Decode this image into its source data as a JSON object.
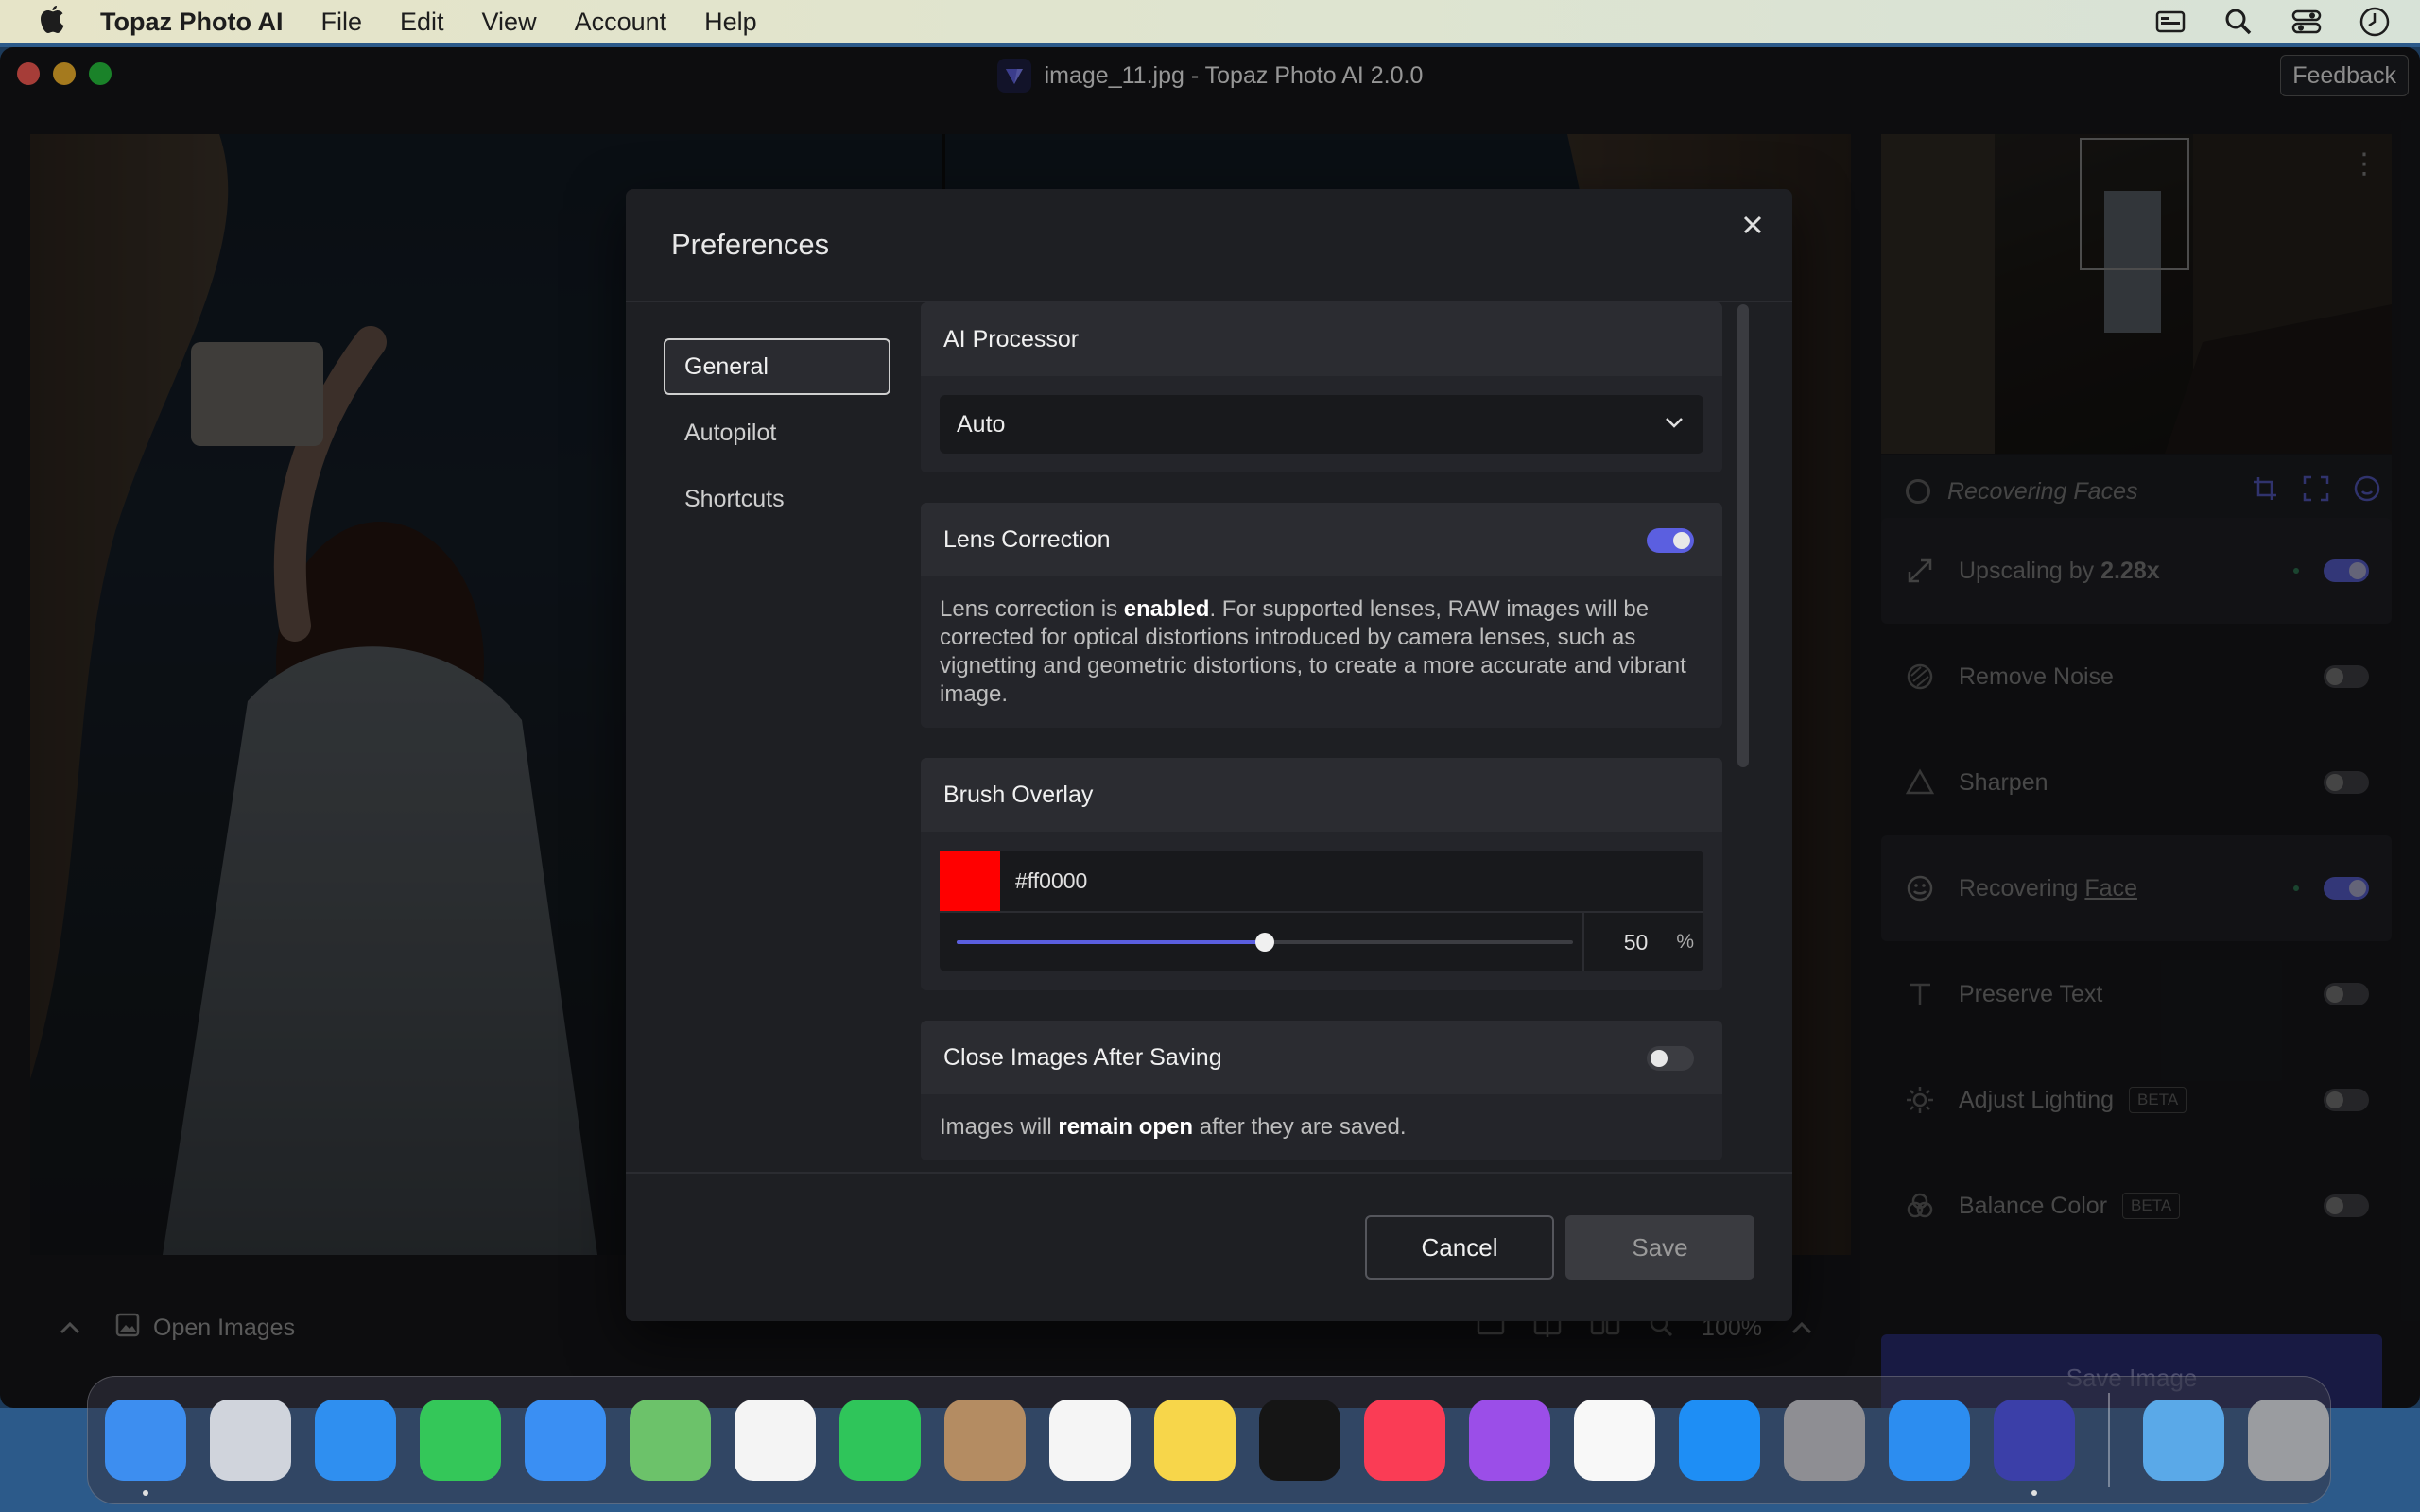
{
  "menubar": {
    "app_name": "Topaz Photo AI",
    "items": [
      "File",
      "Edit",
      "View",
      "Account",
      "Help"
    ]
  },
  "window": {
    "title": "image_11.jpg - Topaz Photo AI 2.0.0",
    "feedback_label": "Feedback"
  },
  "bottombar": {
    "open_images_label": "Open Images",
    "zoom": "100%"
  },
  "rightpanel": {
    "status_text": "Recovering Faces",
    "filters": [
      {
        "label": "Upscaling by ",
        "label_bold": "2.28x",
        "icon": "upscale-icon",
        "enabled": true,
        "active": true
      },
      {
        "label": "Remove Noise",
        "icon": "noise-icon",
        "enabled": false,
        "active": false
      },
      {
        "label": "Sharpen",
        "icon": "sharpen-icon",
        "enabled": false,
        "active": false
      },
      {
        "label": "Recovering ",
        "label_link": "Face",
        "icon": "face-icon",
        "enabled": true,
        "active": true
      },
      {
        "label": "Preserve Text",
        "icon": "text-icon",
        "enabled": false,
        "active": false
      },
      {
        "label": "Adjust Lighting",
        "icon": "lighting-icon",
        "beta": "BETA",
        "enabled": false,
        "active": false
      },
      {
        "label": "Balance Color",
        "icon": "color-icon",
        "beta": "BETA",
        "enabled": false,
        "active": false
      }
    ],
    "save_image_label": "Save Image"
  },
  "prefs": {
    "title": "Preferences",
    "nav": [
      "General",
      "Autopilot",
      "Shortcuts"
    ],
    "ai_processor": {
      "heading": "AI Processor",
      "value": "Auto"
    },
    "lens_correction": {
      "heading": "Lens Correction",
      "enabled": true,
      "desc_prefix": "Lens correction is ",
      "desc_bold": "enabled",
      "desc_suffix": ". For supported lenses, RAW images will be corrected for optical distortions introduced by camera lenses, such as vignetting and geometric distortions, to create a more accurate and vibrant image."
    },
    "brush_overlay": {
      "heading": "Brush Overlay",
      "color": "#ff0000",
      "color_text": "#ff0000",
      "opacity": "50",
      "opacity_unit": "%"
    },
    "close_after_saving": {
      "heading": "Close Images After Saving",
      "enabled": false,
      "desc_prefix": "Images will ",
      "desc_bold": "remain open",
      "desc_suffix": " after they are saved."
    },
    "cancel_label": "Cancel",
    "save_label": "Save"
  },
  "dock": [
    {
      "name": "finder-icon",
      "color": "#3d8ef0",
      "running": true
    },
    {
      "name": "launchpad-icon",
      "color": "#d0d4dc",
      "running": false
    },
    {
      "name": "safari-icon",
      "color": "#2f8ff0",
      "running": false
    },
    {
      "name": "messages-icon",
      "color": "#34c759",
      "running": false
    },
    {
      "name": "mail-icon",
      "color": "#3a8ff3",
      "running": false
    },
    {
      "name": "maps-icon",
      "color": "#6cc26a",
      "running": false
    },
    {
      "name": "photos-icon",
      "color": "#f4f4f4",
      "running": false
    },
    {
      "name": "facetime-icon",
      "color": "#2fc55a",
      "running": false
    },
    {
      "name": "contacts-icon",
      "color": "#b48c62",
      "running": false
    },
    {
      "name": "reminders-icon",
      "color": "#f5f5f5",
      "running": false
    },
    {
      "name": "notes-icon",
      "color": "#f7d64a",
      "running": false
    },
    {
      "name": "tv-icon",
      "color": "#151515",
      "running": false
    },
    {
      "name": "music-icon",
      "color": "#fa3c55",
      "running": false
    },
    {
      "name": "podcasts-icon",
      "color": "#9b4ee8",
      "running": false
    },
    {
      "name": "news-icon",
      "color": "#f8f8f8",
      "running": false
    },
    {
      "name": "app-store-icon",
      "color": "#1e8ef5",
      "running": false
    },
    {
      "name": "system-settings-icon",
      "color": "#8e8e93",
      "running": false
    },
    {
      "name": "topaz-gigapixel-icon",
      "color": "#2c8df0",
      "running": false
    },
    {
      "name": "topaz-photo-ai-icon",
      "color": "#3b3fa8",
      "running": true
    },
    {
      "name": "downloads-folder-icon",
      "color": "#5aa9e8",
      "running": false
    },
    {
      "name": "trash-icon",
      "color": "#9a9ca0",
      "running": false
    }
  ]
}
